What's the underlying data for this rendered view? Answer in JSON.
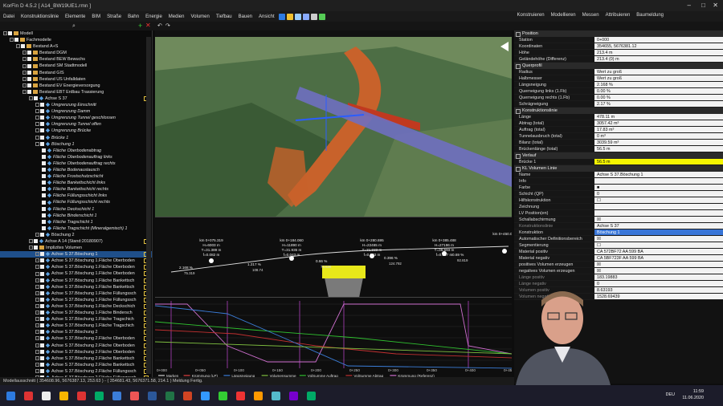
{
  "title": "KorFin D 4.5.2 [ A14_BW19UE1.rmn ]",
  "menus": [
    "Datei",
    "Konstruktionslinie",
    "Elemente",
    "BIM",
    "Straße",
    "Bahn",
    "Energie",
    "Medien",
    "Volumen",
    "Tiefbau",
    "Bauen",
    "Ansicht"
  ],
  "right_menus": [
    "Konstruieren",
    "Modellieren",
    "Messen",
    "Attribuieren",
    "Baumeldung"
  ],
  "tree": [
    {
      "t": "Modell",
      "lvl": 0,
      "k": "f"
    },
    {
      "t": "Fachmodelle",
      "lvl": 1,
      "k": "f"
    },
    {
      "t": "Bestand A+S",
      "lvl": 2,
      "k": "f"
    },
    {
      "t": "Bestand DGM",
      "lvl": 3,
      "k": "f"
    },
    {
      "t": "Bestand BEW Bewuchs",
      "lvl": 3,
      "k": "f"
    },
    {
      "t": "Bestand SM Stadtmodell",
      "lvl": 3,
      "k": "f"
    },
    {
      "t": "Bestand GIS",
      "lvl": 3,
      "k": "f"
    },
    {
      "t": "Bestand US Unfalldaten",
      "lvl": 3,
      "k": "f"
    },
    {
      "t": "Bestand EV Energieversorgung",
      "lvl": 3,
      "k": "f"
    },
    {
      "t": "Bestand EBT Erdbau Trassierung",
      "lvl": 3,
      "k": "f"
    },
    {
      "t": "Achse S 37",
      "lvl": 4,
      "k": "a"
    },
    {
      "t": "Umgrenzung Einschnitt",
      "lvl": 5,
      "k": "i"
    },
    {
      "t": "Umgrenzung Damm",
      "lvl": 5,
      "k": "i"
    },
    {
      "t": "Umgrenzung Tunnel geschlossen",
      "lvl": 5,
      "k": "i"
    },
    {
      "t": "Umgrenzung Tunnel offen",
      "lvl": 5,
      "k": "i"
    },
    {
      "t": "Umgrenzung Brücke",
      "lvl": 5,
      "k": "i"
    },
    {
      "t": "Brücke 1",
      "lvl": 5,
      "k": "i"
    },
    {
      "t": "Böschung 1",
      "lvl": 5,
      "k": "i"
    },
    {
      "t": "Fläche Oberbodenabtrag",
      "lvl": 6,
      "k": "i"
    },
    {
      "t": "Fläche Oberbodenauftrag links",
      "lvl": 6,
      "k": "i"
    },
    {
      "t": "Fläche Oberbodenauftrag rechts",
      "lvl": 6,
      "k": "i"
    },
    {
      "t": "Fläche Bodenaustausch",
      "lvl": 6,
      "k": "i"
    },
    {
      "t": "Fläche Frostschutzschicht",
      "lvl": 6,
      "k": "i"
    },
    {
      "t": "Fläche Bankettschicht links",
      "lvl": 6,
      "k": "i"
    },
    {
      "t": "Fläche Bankettschicht rechts",
      "lvl": 6,
      "k": "i"
    },
    {
      "t": "Fläche Füllungsschicht links",
      "lvl": 6,
      "k": "i"
    },
    {
      "t": "Fläche Füllungsschicht rechts",
      "lvl": 6,
      "k": "i"
    },
    {
      "t": "Fläche Deckschicht 1",
      "lvl": 6,
      "k": "i"
    },
    {
      "t": "Fläche Binderschicht 1",
      "lvl": 6,
      "k": "i"
    },
    {
      "t": "Fläche Tragschicht 1",
      "lvl": 6,
      "k": "i"
    },
    {
      "t": "Fläche Tragschicht (Mineralgemisch) 1",
      "lvl": 6,
      "k": "i"
    },
    {
      "t": "Böschung 2",
      "lvl": 5,
      "k": "n"
    },
    {
      "t": "Achse A 14 (Stand:20180907)",
      "lvl": 4,
      "k": "a"
    },
    {
      "t": "Implizites Volumen",
      "lvl": 4,
      "k": "f"
    },
    {
      "t": "Achse S 37.Böschung 1",
      "lvl": 5,
      "k": "s"
    },
    {
      "t": "Achse S 37.Böschung 1.Fläche Oberboden",
      "lvl": 5,
      "k": "v"
    },
    {
      "t": "Achse S 37.Böschung 1.Fläche Oberboden",
      "lvl": 5,
      "k": "v"
    },
    {
      "t": "Achse S 37.Böschung 1.Fläche Oberboden",
      "lvl": 5,
      "k": "v"
    },
    {
      "t": "Achse S 37.Böschung 1.Fläche Bankettsch",
      "lvl": 5,
      "k": "v"
    },
    {
      "t": "Achse S 37.Böschung 1.Fläche Bankettsch",
      "lvl": 5,
      "k": "v"
    },
    {
      "t": "Achse S 37.Böschung 1.Fläche Füllungssch",
      "lvl": 5,
      "k": "v"
    },
    {
      "t": "Achse S 37.Böschung 1.Fläche Füllungssch",
      "lvl": 5,
      "k": "v"
    },
    {
      "t": "Achse S 37.Böschung 1.Fläche Deckschich",
      "lvl": 5,
      "k": "v"
    },
    {
      "t": "Achse S 37.Böschung 1.Fläche Bindersch",
      "lvl": 5,
      "k": "v"
    },
    {
      "t": "Achse S 37.Böschung 1.Fläche Tragschich",
      "lvl": 5,
      "k": "v"
    },
    {
      "t": "Achse S 37.Böschung 1.Fläche Tragschich",
      "lvl": 5,
      "k": "v"
    },
    {
      "t": "Achse S 37.Böschung 2",
      "lvl": 5,
      "k": "v"
    },
    {
      "t": "Achse S 37.Böschung 2.Fläche Oberboden",
      "lvl": 5,
      "k": "v"
    },
    {
      "t": "Achse S 37.Böschung 2.Fläche Oberboden",
      "lvl": 5,
      "k": "v"
    },
    {
      "t": "Achse S 37.Böschung 2.Fläche Oberboden",
      "lvl": 5,
      "k": "v"
    },
    {
      "t": "Achse S 37.Böschung 2.Fläche Bankettsch",
      "lvl": 5,
      "k": "v"
    },
    {
      "t": "Achse S 37.Böschung 2.Fläche Bankettsch",
      "lvl": 5,
      "k": "v"
    },
    {
      "t": "Achse S 37.Böschung 2.Fläche Füllungssch",
      "lvl": 5,
      "k": "v"
    },
    {
      "t": "Achse S 37.Böschung 2.Fläche Füllungssch",
      "lvl": 5,
      "k": "v"
    }
  ],
  "sections": [
    {
      "head": "Position",
      "rows": [
        [
          "Station",
          "0+000"
        ],
        [
          "Koordinaten",
          "354655, 5676381.12"
        ],
        [
          "Höhe",
          "213.4 m"
        ],
        [
          "Geländehöhe (Differenz)",
          "213.4 (0) m"
        ]
      ]
    },
    {
      "head": "Querprofil",
      "rows": [
        [
          "Radius",
          "Wert zu groß"
        ],
        [
          "Halbmesser",
          "Wert zu groß"
        ],
        [
          "Längsneigung",
          "2.168 %"
        ],
        [
          "Querneigung links (1.Fb)",
          "0.00 %"
        ],
        [
          "Querneigung rechts (1.Fb)",
          "0.00 %"
        ],
        [
          "Schrägneigung",
          "2.17 %"
        ]
      ]
    },
    {
      "head": "Konstruktionslinie",
      "rows": [
        [
          "Länge",
          "478.11 m"
        ],
        [
          "Abtrag (total)",
          "3057.42 m³"
        ],
        [
          "Auftrag (total)",
          "17.83 m³"
        ],
        [
          "Tunnelausbruch (total)",
          "0 m³"
        ],
        [
          "Bilanz (total)",
          "3039.59 m³"
        ],
        [
          "Brückenlänge (total)",
          "56.5 m"
        ]
      ]
    },
    {
      "head": "Verlauf",
      "rows": [
        [
          "Brücke 1",
          "56.5 m",
          "y"
        ]
      ]
    },
    {
      "head": "KL Volumen Linie",
      "rows": [
        [
          "Name",
          "Achse S 37.Böschung 1"
        ],
        [
          "Info",
          ""
        ],
        [
          "Farbe",
          "■"
        ],
        [
          "Schicht (QP)",
          "0"
        ],
        [
          "Hilfskonstruktion",
          "☐"
        ],
        [
          "Zeichnung",
          ""
        ],
        [
          "LV Position(en)",
          ""
        ],
        [
          "Schallabschirmung",
          "☒"
        ],
        [
          "Konstruktionslinie",
          "Achse S 37",
          "dim"
        ],
        [
          "Konstruktion",
          "Böschung 1",
          "sel"
        ],
        [
          "Automatischer Definitionsbereich",
          "☒"
        ],
        [
          "Segmentierung",
          "☐"
        ],
        [
          "Material positiv",
          "CA 572BF72 AA 599 BA"
        ],
        [
          "Material negativ",
          "CA 5BF723F AA 599 BA"
        ],
        [
          "positives Volumen erzeugen",
          "☒"
        ],
        [
          "negatives Volumen erzeugen",
          "☒"
        ],
        [
          "Länge positiv",
          "183.19883",
          "dim"
        ],
        [
          "Länge negativ",
          "0",
          "dim"
        ],
        [
          "Volumen positiv",
          "8.63193",
          "dim"
        ],
        [
          "Volumen negativ",
          "1528.69439",
          "dim"
        ]
      ]
    }
  ],
  "profile_labels": [
    {
      "km": "km 0+075.319",
      "h": "H=6003 m",
      "t": "T=31.389 m",
      "f": "f=0.082 m"
    },
    {
      "km": "km 0+184.060",
      "h": "H=11890 m",
      "t": "T=31.935 m",
      "f": "f=0.043 m"
    },
    {
      "km": "km 0+280.695",
      "h": "H=22465 m",
      "t": "T=31.933 m",
      "f": "f=0.023 m"
    },
    {
      "km": "km 0+385.488",
      "h": "H=27196 m",
      "t": "T=38.593 m",
      "f": "f=0.027 m"
    },
    {
      "km": "km 0+450.000",
      "h": "",
      "t": "",
      "f": ""
    }
  ],
  "profile_grades": [
    "2.168 %",
    "1.217 %",
    "0.66 %",
    "0.396 %",
    "0.69 %"
  ],
  "profile_lengths": [
    "75.319",
    "108.74",
    "76.636",
    "124.792",
    "92.819"
  ],
  "xticks": [
    "0+000",
    "0+050",
    "0+100",
    "0+150",
    "0+200",
    "0+250",
    "0+300",
    "0+350",
    "0+400",
    "0+450"
  ],
  "legend": [
    "Marken",
    "Krümmung (LP)",
    "Längsneigung",
    "Volumensumme",
    "VolSumme Auftrag",
    "VolSumme Abtrag",
    "Krümmung (Referenz)"
  ],
  "legend_colors": [
    "#cccccc",
    "#e04040",
    "#3b7dd8",
    "#7fc040",
    "#30c030",
    "#c03030",
    "#d070d0"
  ],
  "status": "Modellausschnitt   ( 354608.96, 5676387.13, 253.63 ) - ( 354681.43, 5676371.58, 214.1 )     Meldung  Fertig.",
  "clock_time": "11:59",
  "clock_date": "11.06.2020",
  "lang": "DEU"
}
